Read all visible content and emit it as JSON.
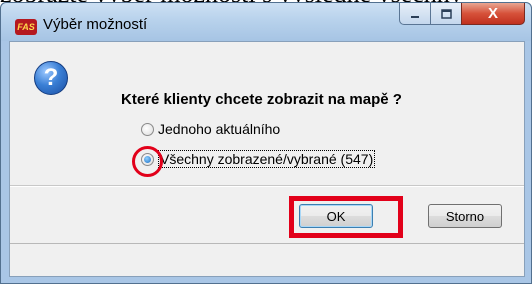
{
  "background": {
    "text": "zobrazte výběr možností s výsledné všechny"
  },
  "window": {
    "title": "Výběr možností",
    "app_icon_text": "FAS",
    "close_glyph": "X"
  },
  "dialog": {
    "question_icon": "?",
    "question": "Které klienty chcete zobrazit na mapě ?",
    "options": [
      {
        "label": "Jednoho aktuálního",
        "checked": false
      },
      {
        "label": "Všechny zobrazené/vybrané (547)",
        "checked": true
      }
    ],
    "buttons": {
      "ok": "OK",
      "cancel": "Storno"
    }
  },
  "annotations": {
    "highlight_color": "#e2001a"
  }
}
